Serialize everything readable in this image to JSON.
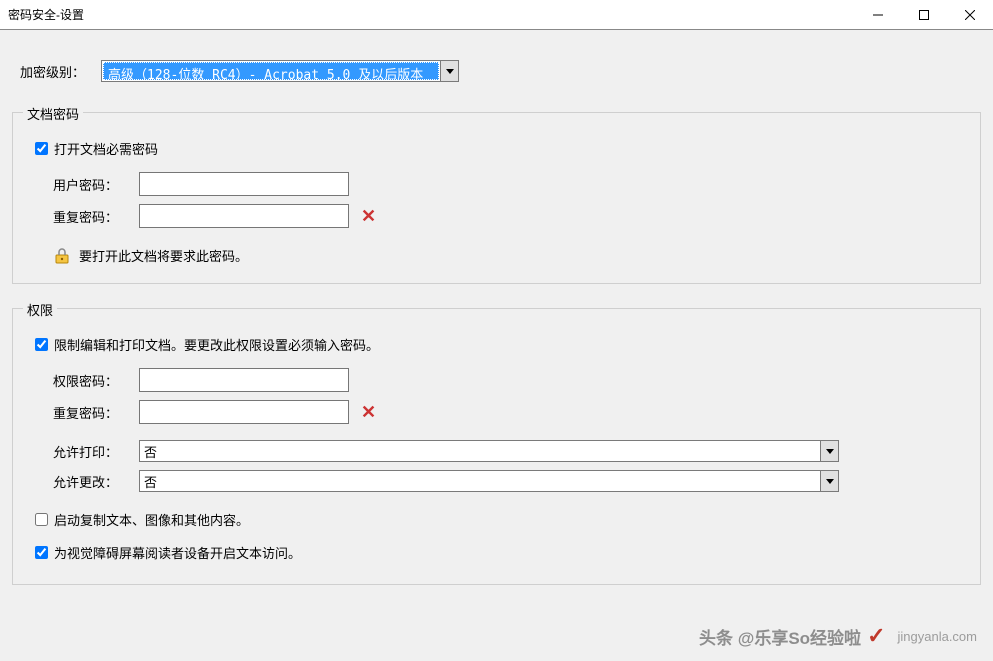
{
  "title": "密码安全-设置",
  "encryptLevel": {
    "label": "加密级别：",
    "selected": "高级（128-位数 RC4）- Acrobat 5.0 及以后版本"
  },
  "docPassword": {
    "legend": "文档密码",
    "requireOpen": {
      "checked": true,
      "label": "打开文档必需密码"
    },
    "userPwLabel": "用户密码：",
    "userPwValue": "",
    "repeatPwLabel": "重复密码：",
    "repeatPwValue": "",
    "info": "要打开此文档将要求此密码。"
  },
  "permissions": {
    "legend": "权限",
    "restrict": {
      "checked": true,
      "label": "限制编辑和打印文档。要更改此权限设置必须输入密码。"
    },
    "permPwLabel": "权限密码：",
    "permPwValue": "",
    "repeatPwLabel": "重复密码：",
    "repeatPwValue": "",
    "allowPrintLabel": "允许打印：",
    "allowPrintValue": "否",
    "allowChangeLabel": "允许更改：",
    "allowChangeValue": "否",
    "enableCopy": {
      "checked": false,
      "label": "启动复制文本、图像和其他内容。"
    },
    "enableAccess": {
      "checked": true,
      "label": "为视觉障碍屏幕阅读者设备开启文本访问。"
    }
  },
  "watermark": {
    "text": "头条 @乐享So经验啦",
    "site": "jingyanla.com"
  }
}
